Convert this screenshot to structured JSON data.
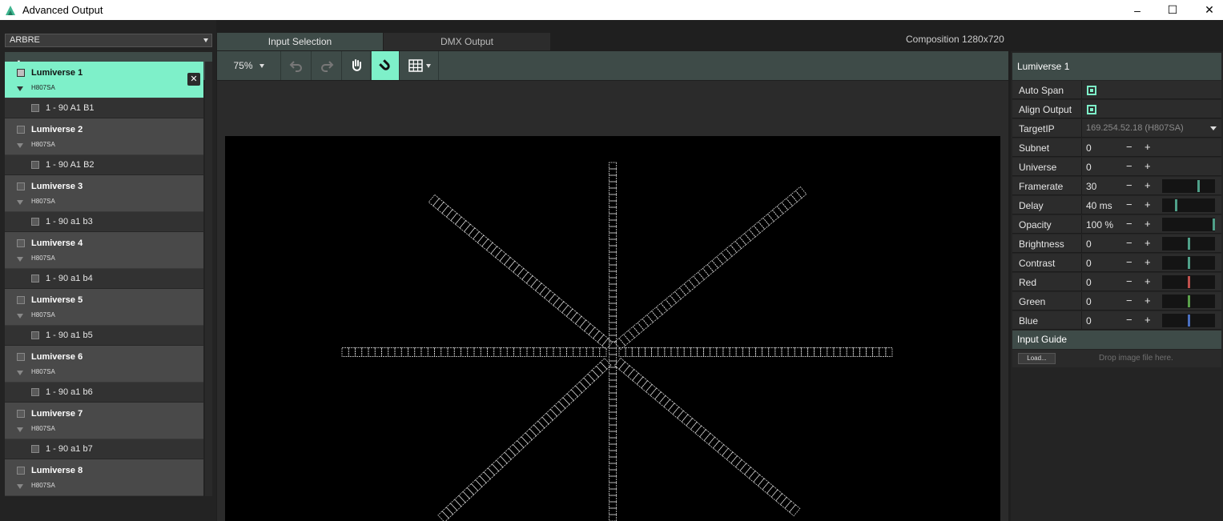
{
  "window": {
    "title": "Advanced Output",
    "minimize": "–",
    "maximize": "☐",
    "close": "✕"
  },
  "preset": {
    "value": "ARBRE"
  },
  "toolbar_left": {
    "add_symbol": "+"
  },
  "universes": [
    {
      "name": "Lumiverse 1",
      "device": "H807SA",
      "slice": "1 - 90 A1 B1",
      "selected": true
    },
    {
      "name": "Lumiverse 2",
      "device": "H807SA",
      "slice": "1 - 90 A1 B2",
      "selected": false
    },
    {
      "name": "Lumiverse 3",
      "device": "H807SA",
      "slice": "1 - 90 a1 b3",
      "selected": false
    },
    {
      "name": "Lumiverse 4",
      "device": "H807SA",
      "slice": "1 - 90 a1 b4",
      "selected": false
    },
    {
      "name": "Lumiverse 5",
      "device": "H807SA",
      "slice": "1 - 90 a1 b5",
      "selected": false
    },
    {
      "name": "Lumiverse 6",
      "device": "H807SA",
      "slice": "1 - 90 a1 b6",
      "selected": false
    },
    {
      "name": "Lumiverse 7",
      "device": "H807SA",
      "slice": "1 - 90 a1 b7",
      "selected": false
    },
    {
      "name": "Lumiverse 8",
      "device": "H807SA",
      "slice": "",
      "selected": false
    }
  ],
  "tabs": {
    "input": "Input Selection",
    "dmx": "DMX Output"
  },
  "composition": "Composition 1280x720",
  "toolbar": {
    "zoom": "75%"
  },
  "properties": {
    "header": "Lumiverse 1",
    "auto_span": {
      "label": "Auto Span",
      "checked": true
    },
    "align_output": {
      "label": "Align Output",
      "checked": true
    },
    "target_ip": {
      "label": "TargetIP",
      "value": "169.254.52.18 (H807SA)"
    },
    "subnet": {
      "label": "Subnet",
      "value": "0"
    },
    "universe": {
      "label": "Universe",
      "value": "0"
    },
    "framerate": {
      "label": "Framerate",
      "value": "30",
      "level": 0.7,
      "color": "#4fa089"
    },
    "delay": {
      "label": "Delay",
      "value": "40 ms",
      "level": 0.25,
      "color": "#4fa089"
    },
    "opacity": {
      "label": "Opacity",
      "value": "100 %",
      "level": 1.0,
      "color": "#4fa089"
    },
    "brightness": {
      "label": "Brightness",
      "value": "0",
      "level": 0.5,
      "color": "#4fa089"
    },
    "contrast": {
      "label": "Contrast",
      "value": "0",
      "level": 0.5,
      "color": "#4fa089"
    },
    "red": {
      "label": "Red",
      "value": "0",
      "level": 0.5,
      "color": "#c0504d"
    },
    "green": {
      "label": "Green",
      "value": "0",
      "level": 0.5,
      "color": "#5aa04a"
    },
    "blue": {
      "label": "Blue",
      "value": "0",
      "level": 0.5,
      "color": "#4a6fc0"
    },
    "minus": "−",
    "plus": "+"
  },
  "input_guide": {
    "header": "Input Guide",
    "load": "Load...",
    "drop_hint": "Drop image file here."
  },
  "canvas": {
    "fixtures": [
      {
        "type": "vertical",
        "pixels": 90
      },
      {
        "type": "horizontal-left",
        "pixels": 90
      },
      {
        "type": "horizontal-right",
        "pixels": 90
      },
      {
        "type": "diag-upper-left",
        "pixels": 90
      },
      {
        "type": "diag-upper-right",
        "pixels": 90
      },
      {
        "type": "diag-lower-left",
        "pixels": 90
      },
      {
        "type": "diag-lower-right",
        "pixels": 90
      }
    ]
  }
}
